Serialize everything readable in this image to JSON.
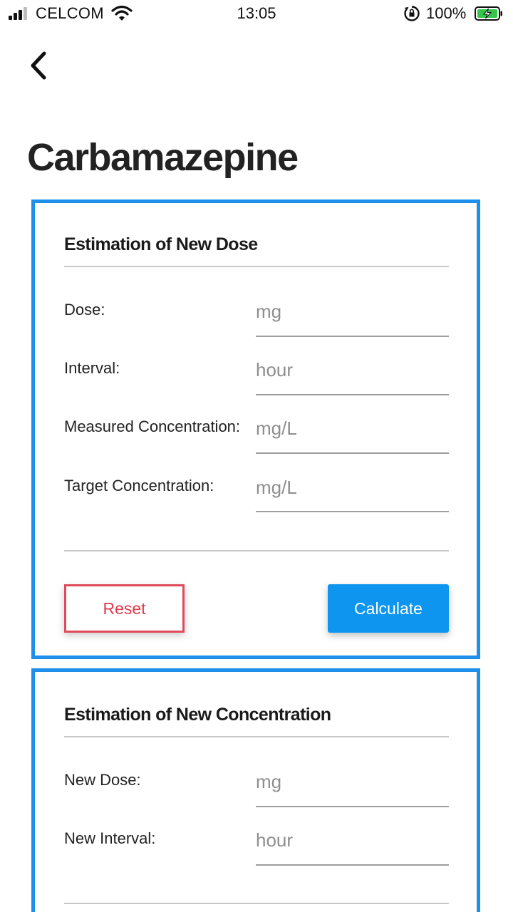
{
  "status_bar": {
    "carrier": "CELCOM",
    "time": "13:05",
    "battery": "100%"
  },
  "header": {
    "title": "Carbamazepine"
  },
  "dose_card": {
    "title": "Estimation of New Dose",
    "fields": [
      {
        "label": "Dose:",
        "placeholder": "mg"
      },
      {
        "label": "Interval:",
        "placeholder": "hour"
      },
      {
        "label": "Measured Concentration:",
        "placeholder": "mg/L"
      },
      {
        "label": "Target Concentration:",
        "placeholder": "mg/L"
      }
    ],
    "reset_label": "Reset",
    "calculate_label": "Calculate"
  },
  "concentration_card": {
    "title": "Estimation of New Concentration",
    "fields": [
      {
        "label": "New Dose:",
        "placeholder": "mg"
      },
      {
        "label": "New Interval:",
        "placeholder": "hour"
      }
    ]
  },
  "colors": {
    "card_border": "#1e8fea",
    "primary_button": "#0d95f0",
    "reset_accent": "#e0394a"
  },
  "icons": [
    "signal-icon",
    "wifi-icon",
    "orientation-lock-icon",
    "battery-charging-icon",
    "back-chevron-icon"
  ]
}
